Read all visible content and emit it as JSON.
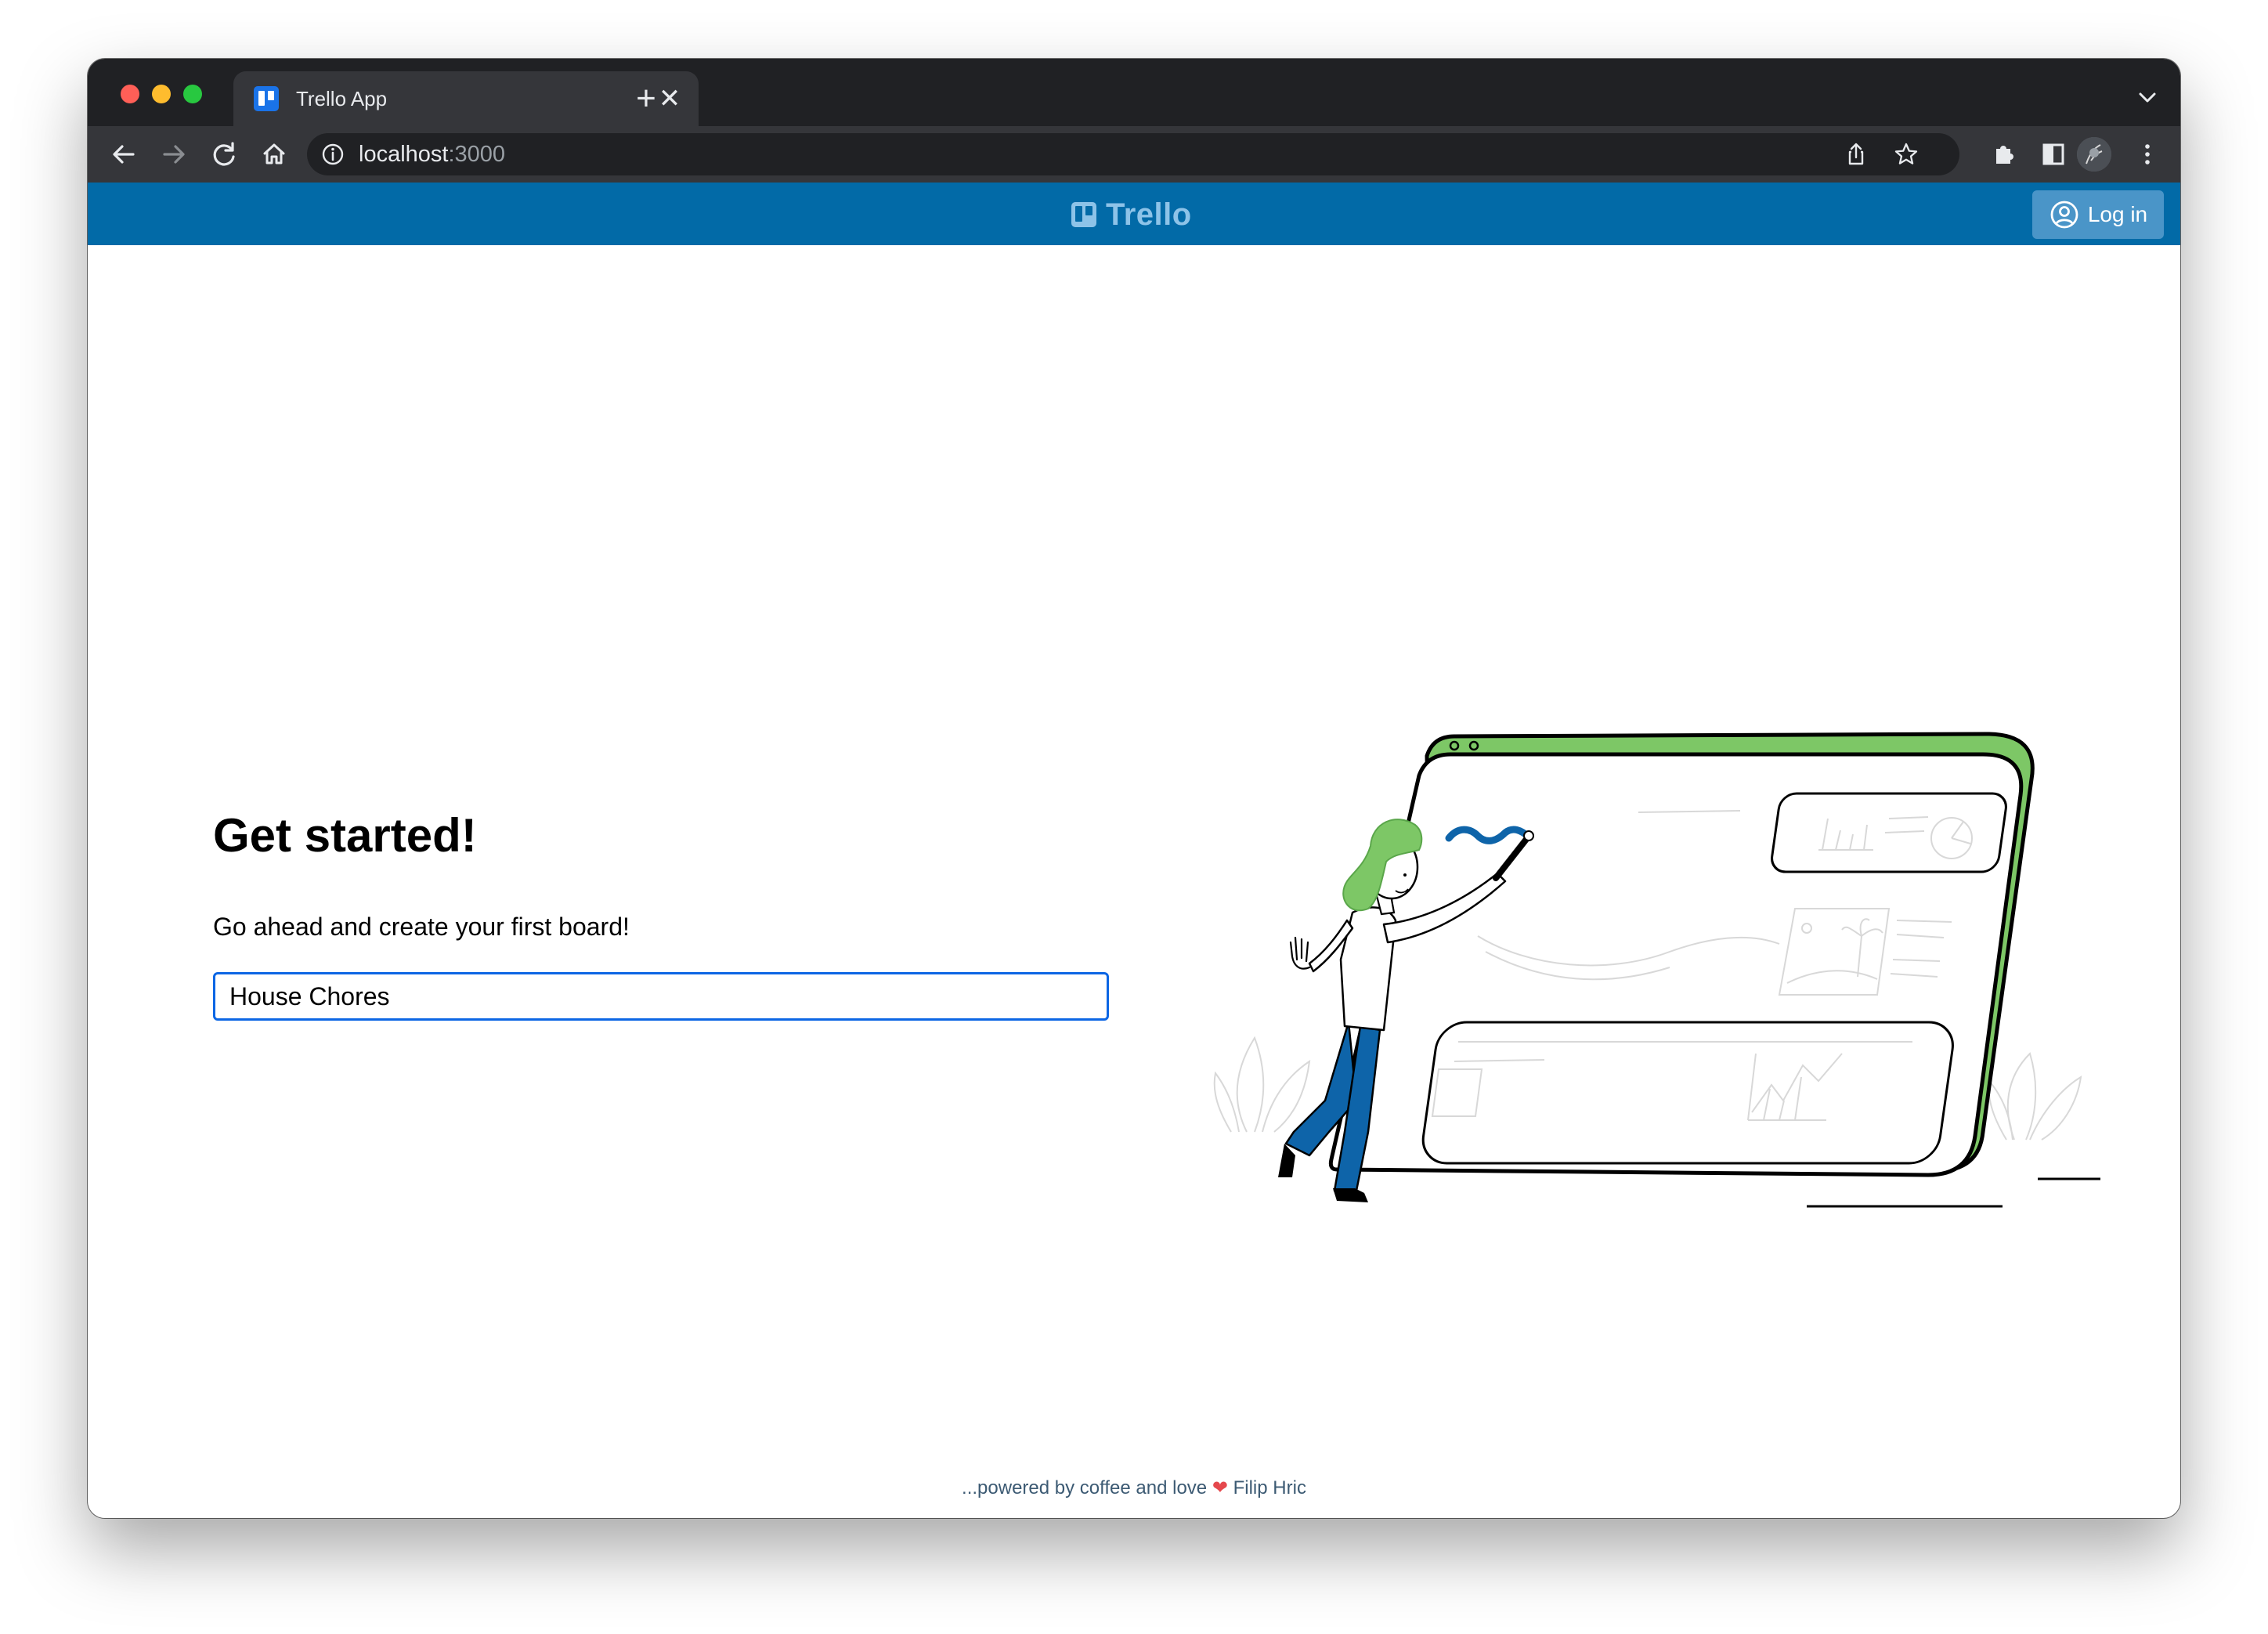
{
  "browser": {
    "tab": {
      "title": "Trello App",
      "close_glyph": "✕"
    },
    "new_tab_glyph": "+",
    "address": {
      "host": "localhost",
      "port": ":3000"
    },
    "icons": [
      "back-arrow-icon",
      "forward-arrow-icon",
      "reload-icon",
      "home-icon",
      "info-icon",
      "share-icon",
      "star-icon",
      "extensions-icon",
      "side-panel-icon",
      "avatar",
      "more-vert-icon",
      "chevron-down-icon"
    ]
  },
  "header": {
    "brand": "Trello",
    "login_label": "Log in",
    "background_color": "#026aa7"
  },
  "main": {
    "heading": "Get started!",
    "subtext": "Go ahead and create your first board!",
    "board_input_value": "House Chores"
  },
  "footer": {
    "text": "...powered by coffee and love",
    "heart": "❤",
    "author": "Filip Hric"
  },
  "colors": {
    "accent": "#0c66e4",
    "illustration_green": "#7dc766",
    "illustration_blue": "#0e64a9"
  }
}
